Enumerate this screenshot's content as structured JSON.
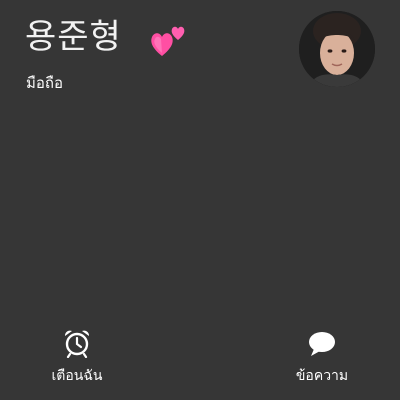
{
  "caller": {
    "name": "용준형",
    "label": "มือถือ",
    "decoration": "two-hearts-icon"
  },
  "actions": [
    {
      "label": "เตือนฉัน",
      "icon": "alarm-clock-icon"
    },
    {
      "label": "ข้อความ",
      "icon": "speech-bubble-icon"
    }
  ],
  "colors": {
    "background": "#363636",
    "text": "#ffffff",
    "heart": "#ff5fa8"
  }
}
